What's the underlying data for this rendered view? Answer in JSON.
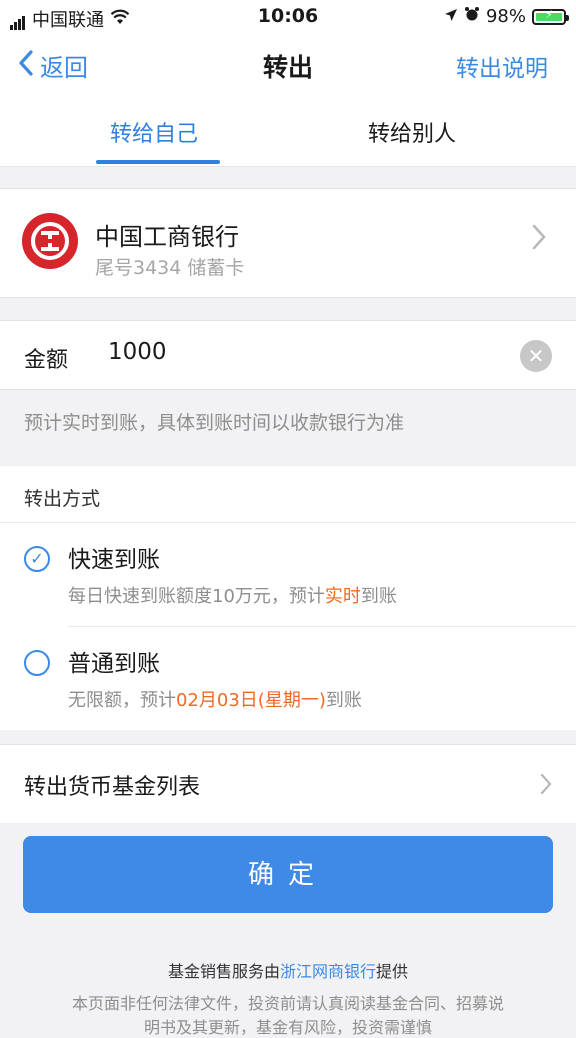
{
  "status_bar": {
    "carrier": "中国联通",
    "time": "10:06",
    "battery": "98%"
  },
  "nav": {
    "back_label": "返回",
    "title": "转出",
    "right_label": "转出说明"
  },
  "tabs": [
    {
      "label": "转给自己",
      "active": true
    },
    {
      "label": "转给别人",
      "active": false
    }
  ],
  "bank": {
    "name": "中国工商银行",
    "detail": "尾号3434 储蓄卡",
    "logo_char": "工"
  },
  "amount": {
    "label": "金额",
    "value": "1000"
  },
  "hint": "预计实时到账，具体到账时间以收款银行为准",
  "method": {
    "header": "转出方式",
    "options": [
      {
        "title": "快速到账",
        "desc_prefix": "每日快速到账额度10万元，预计",
        "desc_highlight": "实时",
        "desc_suffix": "到账",
        "selected": true
      },
      {
        "title": "普通到账",
        "desc_prefix": "无限额，预计",
        "desc_highlight": "02月03日(星期一)",
        "desc_suffix": "到账",
        "selected": false
      }
    ]
  },
  "fund_list_label": "转出货币基金列表",
  "confirm_label": "确定",
  "footer": {
    "prefix": "基金销售服务由",
    "link": "浙江网商银行",
    "suffix": "提供",
    "line2": "本页面非任何法律文件，投资前请认真阅读基金合同、招募说",
    "line3": "明书及其更新，基金有风险，投资需谨慎"
  },
  "colors": {
    "accent": "#3e8ae6",
    "highlight": "#f06a25",
    "bank_red": "#d7252c"
  }
}
